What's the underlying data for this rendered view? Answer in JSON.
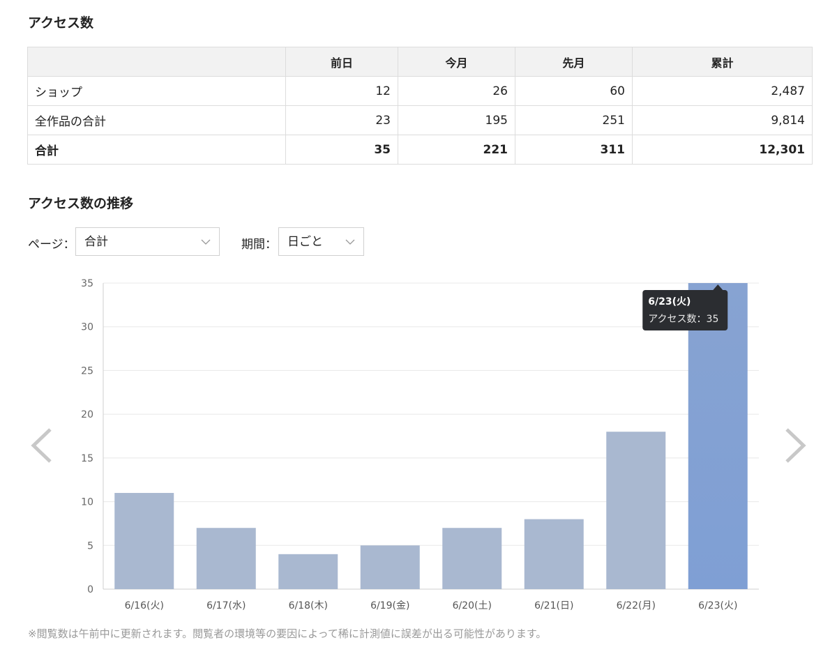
{
  "sections": {
    "access_title": "アクセス数",
    "trend_title": "アクセス数の推移"
  },
  "table": {
    "headers": [
      "",
      "前日",
      "今月",
      "先月",
      "累計"
    ],
    "rows": [
      {
        "label": "ショップ",
        "values": [
          "12",
          "26",
          "60",
          "2,487"
        ]
      },
      {
        "label": "全作品の合計",
        "values": [
          "23",
          "195",
          "251",
          "9,814"
        ]
      },
      {
        "label": "合計",
        "values": [
          "35",
          "221",
          "311",
          "12,301"
        ]
      }
    ]
  },
  "controls": {
    "page_label": "ページ：",
    "page_value": "合計",
    "period_label": "期間：",
    "period_value": "日ごと"
  },
  "icons": {
    "prev": "chevron-left-icon",
    "next": "chevron-right-icon",
    "dropdown": "chevron-down-icon"
  },
  "colors": {
    "bar": "#a9b8d0",
    "bar_highlight": "#87a3d2",
    "tooltip_bg": "#2b2d31"
  },
  "chart_data": {
    "type": "bar",
    "categories": [
      "6/16(火)",
      "6/17(水)",
      "6/18(木)",
      "6/19(金)",
      "6/20(土)",
      "6/21(日)",
      "6/22(月)",
      "6/23(火)"
    ],
    "values": [
      11,
      7,
      4,
      5,
      7,
      8,
      18,
      35
    ],
    "title": "",
    "xlabel": "",
    "ylabel": "",
    "ylim": [
      0,
      35
    ],
    "yticks": [
      0,
      5,
      10,
      15,
      20,
      25,
      30,
      35
    ],
    "grid": true,
    "highlight_index": 7,
    "tooltip": {
      "title": "6/23(火)",
      "text": "アクセス数：35"
    }
  },
  "footnote": "※閲覧数は午前中に更新されます。閲覧者の環境等の要因によって稀に計測値に誤差が出る可能性があります。"
}
